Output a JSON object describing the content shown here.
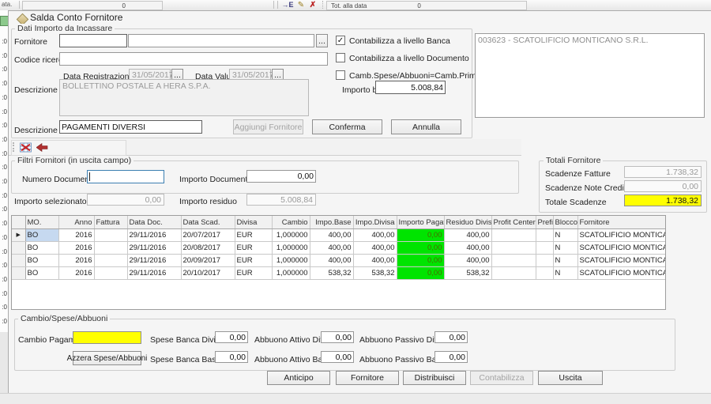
{
  "top_bar": {
    "left_label": "ata.",
    "left_value": "0",
    "icons": [
      {
        "name": "expand-icon",
        "glyph": "→E"
      },
      {
        "name": "pencil-icon",
        "glyph": "✎"
      },
      {
        "name": "cancel-icon",
        "glyph": "✗"
      }
    ],
    "tot_label": "Tot. alla data",
    "tot_value": "0"
  },
  "left_strip": {
    "cell_text": ":0",
    "count": 21
  },
  "dialog_title": "Salda Conto Fornitore",
  "dati_importo": {
    "legend": "Dati Importo da Incassare",
    "fornitore_label": "Fornitore",
    "fornitore_code_value": "",
    "fornitore_name_value": "",
    "browse_label": "...",
    "codice_ricerca_label": "Codice ricerca",
    "codice_ricerca_value": "",
    "data_registrazione_label": "Data Registrazione",
    "data_registrazione_value": "31/05/2017",
    "data_valuta_label": "Data Valuta",
    "data_valuta_value": "31/05/2017",
    "descrizione_hb_label": "Descrizione HB",
    "descrizione_hb_value": "BOLLETTINO POSTALE A HERA S.P.A.",
    "checkboxes": [
      {
        "label": "Contabilizza a livello Banca",
        "checked": true
      },
      {
        "label": "Contabilizza a livello Documento",
        "checked": false
      },
      {
        "label": "Camb.Spese/Abbuoni=Camb.Prima Rata",
        "checked": false
      }
    ],
    "importo_base_label": "Importo base",
    "importo_base_value": "5.008,84",
    "supplier_list": [
      "003623 - SCATOLIFICIO MONTICANO S.R.L."
    ],
    "descrizione_label": "Descrizione",
    "descrizione_value": "PAGAMENTI DIVERSI",
    "buttons": {
      "aggiungi": {
        "label": "Aggiungi Fornitore",
        "disabled": true
      },
      "conferma": {
        "label": "Conferma",
        "disabled": false
      },
      "annulla": {
        "label": "Annulla",
        "disabled": false
      }
    }
  },
  "filtri": {
    "legend": "Filtri Fornitori (in uscita campo)",
    "numero_documento_label": "Numero Documento",
    "numero_documento_value": "",
    "importo_documento_label": "Importo Documento",
    "importo_documento_value": "0,00",
    "importo_selezionato_label": "Importo selezionato",
    "importo_selezionato_value": "0,00",
    "importo_residuo_label": "Importo residuo",
    "importo_residuo_value": "5.008,84"
  },
  "totali": {
    "legend": "Totali Fornitore",
    "rows": [
      {
        "label": "Scadenze Fatture",
        "value": "1.738,32",
        "highlight": false
      },
      {
        "label": "Scadenze Note Credito",
        "value": "0,00",
        "highlight": false
      },
      {
        "label": "Totale Scadenze",
        "value": "1.738,32",
        "highlight": true
      }
    ]
  },
  "grid": {
    "selector_width": 17,
    "columns": [
      {
        "label": "MO.",
        "width": 42,
        "align": "left"
      },
      {
        "label": "Anno",
        "width": 45,
        "align": "right"
      },
      {
        "label": "Fattura",
        "width": 42,
        "align": "left"
      },
      {
        "label": "Data Doc.",
        "width": 68,
        "align": "left"
      },
      {
        "label": "Data Scad.",
        "width": 68,
        "align": "left"
      },
      {
        "label": "Divisa",
        "width": 47,
        "align": "left"
      },
      {
        "label": "Cambio",
        "width": 48,
        "align": "right"
      },
      {
        "label": "Impo.Base",
        "width": 55,
        "align": "right"
      },
      {
        "label": "Impo.Divisa",
        "width": 55,
        "align": "right"
      },
      {
        "label": "Importo Pagato",
        "width": 60,
        "align": "right",
        "highlight": "green"
      },
      {
        "label": "Residuo Divisa",
        "width": 60,
        "align": "right"
      },
      {
        "label": "Profit Center",
        "width": 56,
        "align": "left"
      },
      {
        "label": "Prefi",
        "width": 22,
        "align": "left"
      },
      {
        "label": "Blocco",
        "width": 31,
        "align": "left"
      },
      {
        "label": "Fornitore",
        "width": 113,
        "align": "left"
      }
    ],
    "rows": [
      {
        "selected": true,
        "cells": [
          "BO",
          "2016",
          "",
          "29/11/2016",
          "20/07/2017",
          "EUR",
          "1,000000",
          "400,00",
          "400,00",
          "0,00",
          "400,00",
          "",
          "",
          "N",
          "SCATOLIFICIO MONTICANO"
        ]
      },
      {
        "selected": false,
        "cells": [
          "BO",
          "2016",
          "",
          "29/11/2016",
          "20/08/2017",
          "EUR",
          "1,000000",
          "400,00",
          "400,00",
          "0,00",
          "400,00",
          "",
          "",
          "N",
          "SCATOLIFICIO MONTICANO"
        ]
      },
      {
        "selected": false,
        "cells": [
          "BO",
          "2016",
          "",
          "29/11/2016",
          "20/09/2017",
          "EUR",
          "1,000000",
          "400,00",
          "400,00",
          "0,00",
          "400,00",
          "",
          "",
          "N",
          "SCATOLIFICIO MONTICANO"
        ]
      },
      {
        "selected": false,
        "cells": [
          "BO",
          "2016",
          "",
          "29/11/2016",
          "20/10/2017",
          "EUR",
          "1,000000",
          "538,32",
          "538,32",
          "0,00",
          "538,32",
          "",
          "",
          "N",
          "SCATOLIFICIO MONTICANO"
        ]
      }
    ]
  },
  "cambio": {
    "legend": "Cambio/Spese/Abbuoni",
    "cambio_pagamento_label": "Cambio Pagamento",
    "cambio_pagamento_value": "",
    "azzera_label": "Azzera Spese/Abbuoni",
    "fields": [
      {
        "label": "Spese Banca Divisa",
        "value": "0,00"
      },
      {
        "label": "Spese Banca Base",
        "value": "0,00"
      },
      {
        "label": "Abbuono Attivo Divisa",
        "value": "0,00"
      },
      {
        "label": "Abbuono Attivo Base",
        "value": "0,00"
      },
      {
        "label": "Abbuono Passivo Divisa",
        "value": "0,00"
      },
      {
        "label": "Abbuono Passivo Base",
        "value": "0,00"
      }
    ]
  },
  "footer_buttons": [
    {
      "label": "Anticipo",
      "disabled": false
    },
    {
      "label": "Fornitore",
      "disabled": false
    },
    {
      "label": "Distribuisci",
      "disabled": false
    },
    {
      "label": "Contabilizza",
      "disabled": true
    },
    {
      "label": "Uscita",
      "disabled": false
    }
  ],
  "colors": {
    "highlight_yellow": "#ffff00",
    "paid_green": "#00e400",
    "selection_blue": "#c6d9f0"
  }
}
